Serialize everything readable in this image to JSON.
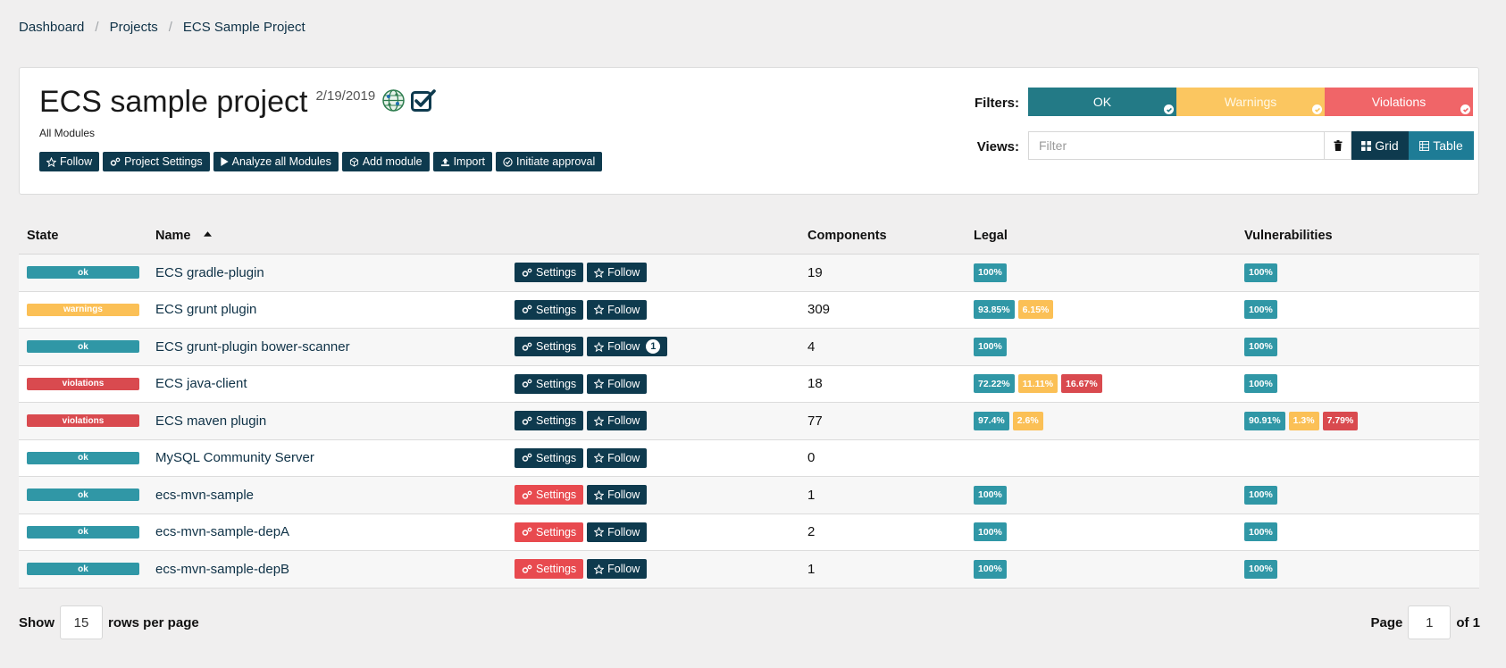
{
  "breadcrumb": [
    "Dashboard",
    "Projects",
    "ECS Sample Project"
  ],
  "project": {
    "title": "ECS sample project",
    "date": "2/19/2019",
    "subtitle": "All Modules",
    "actions": {
      "follow": "Follow",
      "settings": "Project Settings",
      "analyze": "Analyze all Modules",
      "add_module": "Add module",
      "import": "Import",
      "approval": "Initiate approval"
    }
  },
  "filters": {
    "label": "Filters:",
    "ok": "OK",
    "warnings": "Warnings",
    "violations": "Violations"
  },
  "views": {
    "label": "Views:",
    "placeholder": "Filter",
    "grid": "Grid",
    "table": "Table"
  },
  "table": {
    "headers": {
      "state": "State",
      "name": "Name",
      "components": "Components",
      "legal": "Legal",
      "vulnerabilities": "Vulnerabilities"
    },
    "settings_label": "Settings",
    "follow_label": "Follow",
    "rows": [
      {
        "state": "ok",
        "name": "ECS gradle-plugin",
        "components": "19",
        "legal": [
          "100%"
        ],
        "vuln": [
          "100%"
        ]
      },
      {
        "state": "warnings",
        "name": "ECS grunt plugin",
        "components": "309",
        "legal": [
          "93.85%",
          "6.15%"
        ],
        "vuln": [
          "100%"
        ]
      },
      {
        "state": "ok",
        "name": "ECS grunt-plugin bower-scanner",
        "components": "4",
        "legal": [
          "100%"
        ],
        "vuln": [
          "100%"
        ],
        "follow_count": "1"
      },
      {
        "state": "violations",
        "name": "ECS java-client",
        "components": "18",
        "legal": [
          "72.22%",
          "11.11%",
          "16.67%"
        ],
        "vuln": [
          "100%"
        ]
      },
      {
        "state": "violations",
        "name": "ECS maven plugin",
        "components": "77",
        "legal": [
          "97.4%",
          "2.6%"
        ],
        "vuln": [
          "90.91%",
          "1.3%",
          "7.79%"
        ]
      },
      {
        "state": "ok",
        "name": "MySQL Community Server",
        "components": "0",
        "legal": [],
        "vuln": []
      },
      {
        "state": "ok",
        "name": "ecs-mvn-sample",
        "components": "1",
        "legal": [
          "100%"
        ],
        "vuln": [
          "100%"
        ],
        "settings_alert": true
      },
      {
        "state": "ok",
        "name": "ecs-mvn-sample-depA",
        "components": "2",
        "legal": [
          "100%"
        ],
        "vuln": [
          "100%"
        ],
        "settings_alert": true
      },
      {
        "state": "ok",
        "name": "ecs-mvn-sample-depB",
        "components": "1",
        "legal": [
          "100%"
        ],
        "vuln": [
          "100%"
        ],
        "settings_alert": true
      }
    ]
  },
  "pagination": {
    "show": "Show",
    "rows_per_page_value": "15",
    "rows_per_page": "rows per page",
    "page": "Page",
    "page_value": "1",
    "of": "of 1"
  },
  "colors": {
    "ok": "#3097a6",
    "warning": "#fbc056",
    "violation": "#d94a4f",
    "primary": "#0e3a4e"
  }
}
